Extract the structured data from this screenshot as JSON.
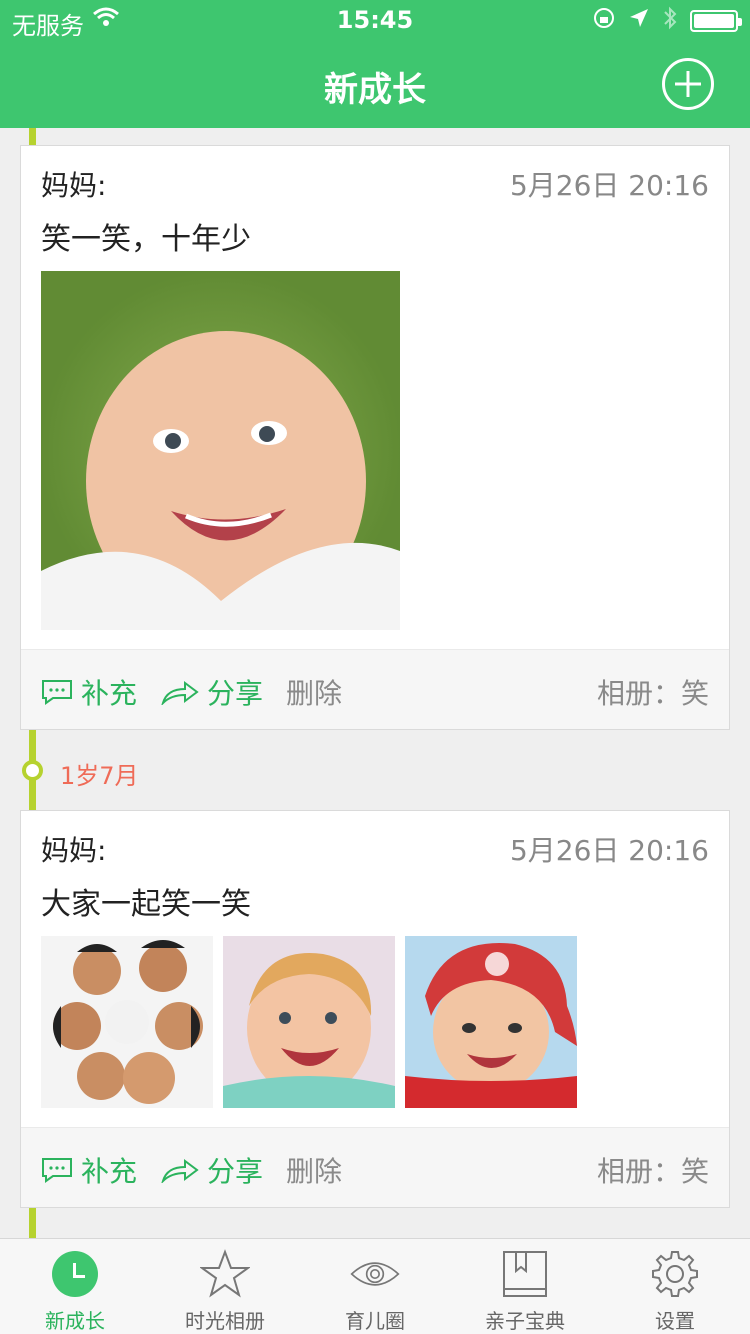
{
  "status_bar": {
    "carrier": "无服务",
    "time": "15:45"
  },
  "header": {
    "title": "新成长"
  },
  "timeline": {
    "age_label": "1岁7月"
  },
  "posts": [
    {
      "author": "妈妈:",
      "date": "5月26日 20:16",
      "text": "笑一笑，十年少",
      "actions": {
        "supplement": "补充",
        "share": "分享",
        "delete": "删除"
      },
      "album": "相册：笑"
    },
    {
      "author": "妈妈:",
      "date": "5月26日 20:16",
      "text": "大家一起笑一笑",
      "actions": {
        "supplement": "补充",
        "share": "分享",
        "delete": "删除"
      },
      "album": "相册：笑"
    }
  ],
  "tabs": [
    {
      "label": "新成长",
      "icon": "clock-icon",
      "active": true
    },
    {
      "label": "时光相册",
      "icon": "star-icon"
    },
    {
      "label": "育儿圈",
      "icon": "eye-icon"
    },
    {
      "label": "亲子宝典",
      "icon": "book-icon"
    },
    {
      "label": "设置",
      "icon": "gear-icon"
    }
  ],
  "colors": {
    "brand_green": "#3ec66f",
    "timeline": "#b6d22f",
    "age_label": "#ef6b57"
  }
}
